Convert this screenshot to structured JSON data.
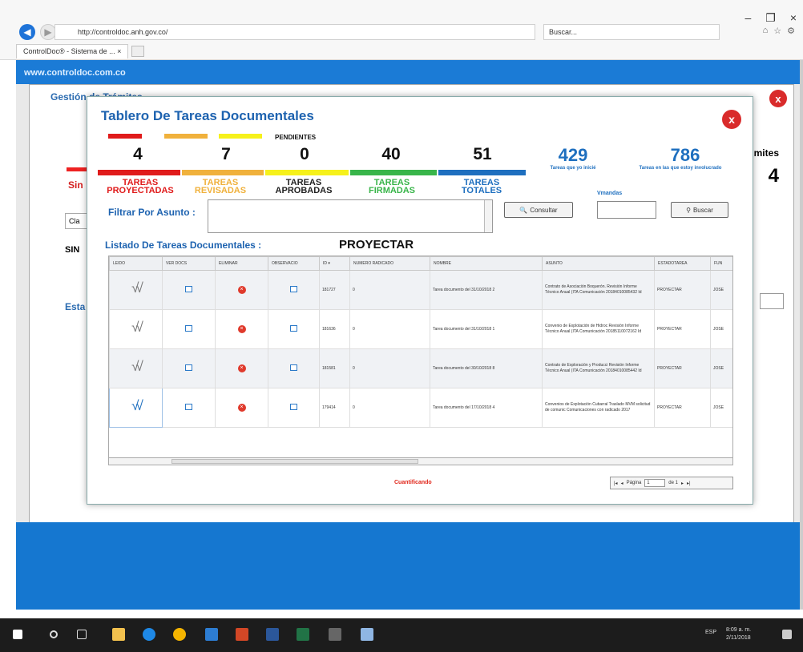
{
  "browser": {
    "address": "http://controldoc.anh.gov.co/",
    "search_placeholder": "Buscar...",
    "tab_label": "ControlDoc® - Sistema de ... ×",
    "controls": {
      "minimize": "–",
      "restore": "❐",
      "close": "×"
    }
  },
  "background_page": {
    "banner": "www.controldoc.com.co",
    "title": "Gestión de Trámites",
    "close_label": "x",
    "sin": "Sin",
    "cla": "Cla",
    "sin2": "SIN",
    "esta": "Esta",
    "mites": "mites",
    "big_number": "4"
  },
  "modal": {
    "title": "Tablero De Tareas Documentales",
    "close_label": "x",
    "pending_label": "PENDIENTES",
    "counts": [
      {
        "value": "4",
        "label1": "TAREAS",
        "label2": "PROYECTADAS",
        "color": "#e01b1b"
      },
      {
        "value": "7",
        "label1": "TAREAS",
        "label2": "REVISADAS",
        "color": "#f0b13c"
      },
      {
        "value": "0",
        "label1": "TAREAS",
        "label2": "APROBADAS",
        "color": "#f6f11b"
      },
      {
        "value": "40",
        "label1": "TAREAS",
        "label2": "FIRMADAS",
        "color": "#39b54a"
      },
      {
        "value": "51",
        "label1": "TAREAS",
        "label2": "TOTALES",
        "color": "#1e6fbf"
      }
    ],
    "kpi1": {
      "value": "429",
      "label": "Tareas que yo inicié"
    },
    "kpi2": {
      "value": "786",
      "label": "Tareas en las que estoy involucrado"
    },
    "vmandas": "Vmandas",
    "filter_label": "Filtrar Por Asunto :",
    "consult_button": "Consultar",
    "search_button": "Buscar",
    "list_label": "Listado De Tareas Documentales :",
    "mode": "PROYECTAR",
    "columns": [
      "LEIDO",
      "VER DOCS",
      "ELIMINAR",
      "OBSERVACIO",
      "ID ▾",
      "NUMERO RADICADO",
      "NOMBRE",
      "ASUNTO",
      "ESTADOTAREA",
      "FUN"
    ],
    "rows": [
      {
        "id": "181727",
        "radicado": "0",
        "nombre": "Tarea documento del 31/10/2018 2",
        "asunto": "Contrato de Asociación Boquerón. Revisión Informe Técnico Anual (ITA Comunicación 20184010085432 Id",
        "estado": "PROYECTAR",
        "fun": "JOSE"
      },
      {
        "id": "181636",
        "radicado": "0",
        "nombre": "Tarea documento del 31/10/2018 1",
        "asunto": "Convenio de Explotación de Hidroc Revisión Informe Técnico Anual (ITA Comunicación 20185110072162 Id",
        "estado": "PROYECTAR",
        "fun": "JOSE"
      },
      {
        "id": "181581",
        "radicado": "0",
        "nombre": "Tarea documento del 30/10/2018 8",
        "asunto": "Contrato de Exploración y Producci Revisión Informe Técnico Anual (ITA Comunicación 20184010085442 Id",
        "estado": "PROYECTAR",
        "fun": "JOSE"
      },
      {
        "id": "179414",
        "radicado": "0",
        "nombre": "Tarea documento del 17/10/2018 4",
        "asunto": "Convenios de Explotación Cubarral Traslado MVM solicitud de comunic Comunicaciones con radicado 2017",
        "estado": "PROYECTAR",
        "fun": "JOSE"
      }
    ],
    "status": "Cuantificando",
    "pager": {
      "first": "|◂",
      "prev": "◂",
      "page_label": "Página",
      "page_value": "1",
      "of": "de 1",
      "next": "▸",
      "last": "▸|"
    }
  },
  "taskbar": {
    "lang": "ESP",
    "time": "8:09 a. m.",
    "date": "2/11/2018"
  }
}
